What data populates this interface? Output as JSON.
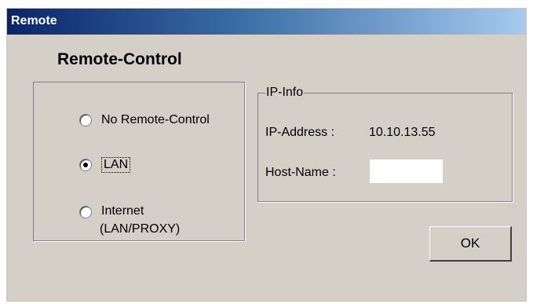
{
  "window": {
    "title": "Remote"
  },
  "heading": "Remote-Control",
  "modes": {
    "none": {
      "label": "No Remote-Control",
      "checked": false
    },
    "lan": {
      "label": "LAN",
      "checked": true
    },
    "internet": {
      "label_line1": "Internet",
      "label_line2": "(LAN/PROXY)",
      "checked": false
    }
  },
  "ip_info": {
    "legend": "IP-Info",
    "ip_label": "IP-Address :",
    "ip_value": "10.10.13.55",
    "host_label": "Host-Name :",
    "host_value": ""
  },
  "buttons": {
    "ok": "OK"
  },
  "colors": {
    "dialog_bg": "#d4d0c8",
    "title_start": "#0a246a",
    "title_end": "#a6caf0"
  }
}
